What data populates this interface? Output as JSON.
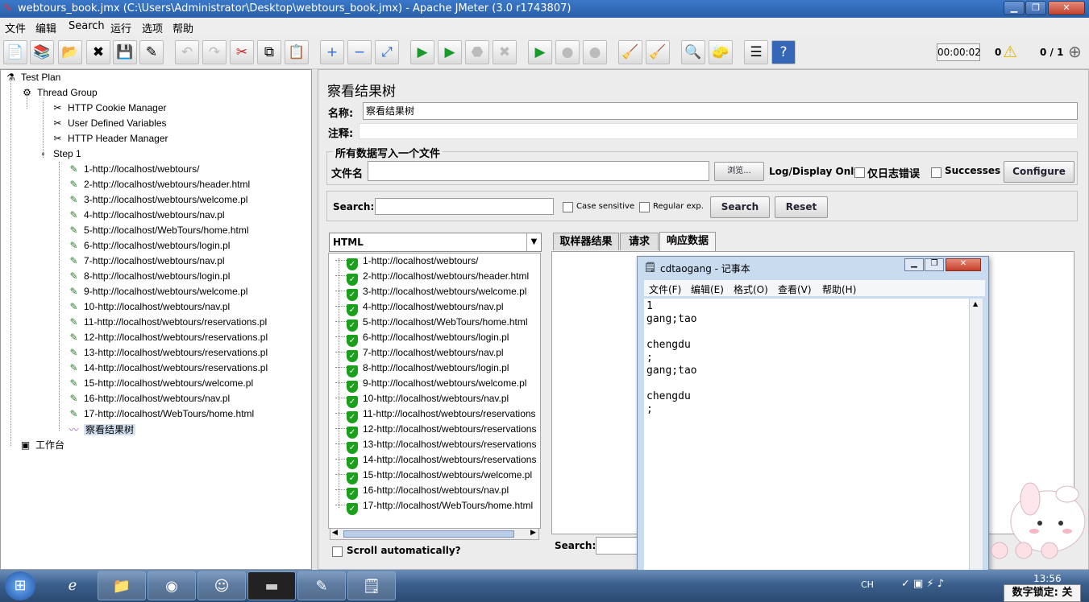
{
  "window": {
    "title": "webtours_book.jmx (C:\\Users\\Administrator\\Desktop\\webtours_book.jmx) - Apache JMeter (3.0 r1743807)",
    "min_label": "▁",
    "max_label": "❐",
    "close_label": "✕"
  },
  "menu": [
    "文件",
    "编辑",
    "Search",
    "运行",
    "选项",
    "帮助"
  ],
  "toolbar": {
    "timer": "00:00:02",
    "warn_count": "0",
    "threads": "0 / 1",
    "icons": [
      "new-icon",
      "templates-icon",
      "open-icon",
      "close-file-icon",
      "save-icon",
      "save-screenshot-icon",
      "undo-icon",
      "redo-icon",
      "cut-icon",
      "copy-icon",
      "paste-icon",
      "expand-icon",
      "collapse-icon",
      "toggle-icon",
      "start-icon",
      "start-no-pause-icon",
      "stop-icon",
      "shutdown-icon",
      "remote-start-icon",
      "remote-stop-icon",
      "remote-exit-icon",
      "clear-icon",
      "clear-all-icon",
      "search-icon",
      "reset-search-icon",
      "function-helper-icon",
      "help-icon"
    ]
  },
  "tree": {
    "root": "Test Plan",
    "thread_group": "Thread Group",
    "config": [
      "HTTP Cookie Manager",
      "User Defined Variables",
      "HTTP Header Manager"
    ],
    "step": "Step 1",
    "samplers": [
      "1-http://localhost/webtours/",
      "2-http://localhost/webtours/header.html",
      "3-http://localhost/webtours/welcome.pl",
      "4-http://localhost/webtours/nav.pl",
      "5-http://localhost/WebTours/home.html",
      "6-http://localhost/webtours/login.pl",
      "7-http://localhost/webtours/nav.pl",
      "8-http://localhost/webtours/login.pl",
      "9-http://localhost/webtours/welcome.pl",
      "10-http://localhost/webtours/nav.pl",
      "11-http://localhost/webtours/reservations.pl",
      "12-http://localhost/webtours/reservations.pl",
      "13-http://localhost/webtours/reservations.pl",
      "14-http://localhost/webtours/reservations.pl",
      "15-http://localhost/webtours/welcome.pl",
      "16-http://localhost/webtours/nav.pl",
      "17-http://localhost/WebTours/home.html"
    ],
    "listener": "察看结果树",
    "workbench": "工作台"
  },
  "panel": {
    "heading": "察看结果树",
    "name_label": "名称:",
    "name_value": "察看结果树",
    "comment_label": "注释:",
    "comment_value": "",
    "file_group_title": "所有数据写入一个文件",
    "file_label": "文件名",
    "file_value": "",
    "browse_label": "浏览...",
    "log_display_label": "Log/Display Only:",
    "errors_label": "仅日志错误",
    "successes_label": "Successes",
    "configure_label": "Configure",
    "search_label": "Search:",
    "search_value": "",
    "case_label": "Case sensitive",
    "regex_label": "Regular exp.",
    "search_btn": "Search",
    "reset_btn": "Reset",
    "renderer": "HTML",
    "results": [
      "1-http://localhost/webtours/",
      "2-http://localhost/webtours/header.html",
      "3-http://localhost/webtours/welcome.pl",
      "4-http://localhost/webtours/nav.pl",
      "5-http://localhost/WebTours/home.html",
      "6-http://localhost/webtours/login.pl",
      "7-http://localhost/webtours/nav.pl",
      "8-http://localhost/webtours/login.pl",
      "9-http://localhost/webtours/welcome.pl",
      "10-http://localhost/webtours/nav.pl",
      "11-http://localhost/webtours/reservations",
      "12-http://localhost/webtours/reservations",
      "13-http://localhost/webtours/reservations",
      "14-http://localhost/webtours/reservations",
      "15-http://localhost/webtours/welcome.pl",
      "16-http://localhost/webtours/nav.pl",
      "17-http://localhost/WebTours/home.html"
    ],
    "scroll_auto": "Scroll automatically?",
    "tabs": [
      "取样器结果",
      "请求",
      "响应数据"
    ],
    "bottom_search_label": "Search:"
  },
  "notepad": {
    "title": "cdtaogang - 记事本",
    "menu": [
      "文件(F)",
      "编辑(E)",
      "格式(O)",
      "查看(V)",
      "帮助(H)"
    ],
    "content": "1\ngang;tao\n\nchengdu\n;\ngang;tao\n\nchengdu\n;"
  },
  "taskbar": {
    "clock": "13:56",
    "ime_status": "数字锁定: 关",
    "lang": "CH"
  }
}
